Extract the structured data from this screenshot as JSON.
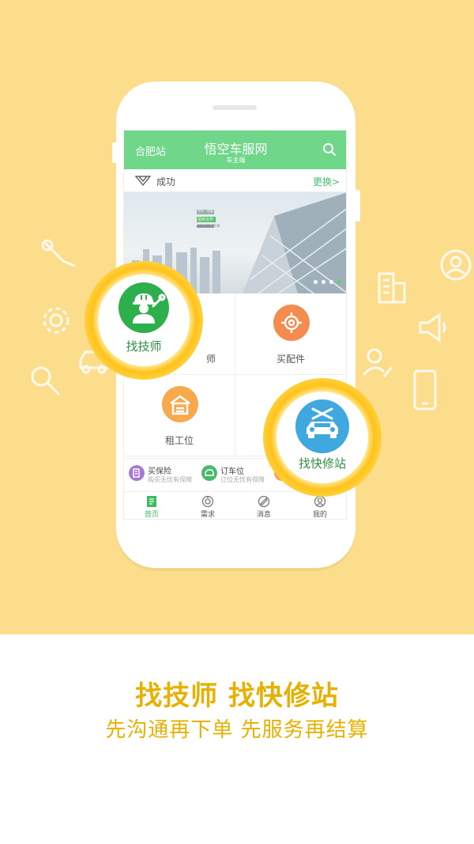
{
  "colors": {
    "background": "#fcdd8b",
    "accent": "#6fd68a",
    "headline": "#e6b100",
    "ring": "#ffc21a"
  },
  "app": {
    "city": "合肥站",
    "title": "悟空车服网",
    "subtitle": "车主端",
    "car_name": "成功",
    "change_label": "更换>",
    "banner": {
      "tag": "招商合作",
      "phone": "400-865-5538",
      "small": "合作 · 加盟",
      "active_slide": 4,
      "slide_count": 4
    }
  },
  "grid": {
    "tech_partial": "师",
    "parts": "买配件",
    "rent": "租工位"
  },
  "promos": [
    {
      "title": "买保险",
      "sub": "购买无忧有保障",
      "icon": "insurance-icon"
    },
    {
      "title": "订车位",
      "sub": "订位无忧有保障",
      "icon": "parking-icon"
    }
  ],
  "tabs": [
    {
      "label": "首页",
      "icon": "home-icon",
      "active": true
    },
    {
      "label": "需求",
      "icon": "demand-icon",
      "active": false
    },
    {
      "label": "消息",
      "icon": "message-icon",
      "active": false
    },
    {
      "label": "我的",
      "icon": "profile-icon",
      "active": false
    }
  ],
  "callouts": {
    "technician": "找技师",
    "repair_station": "找快修站"
  },
  "marketing": {
    "headline": "找技师 找快修站",
    "subline": "先沟通再下单 先服务再结算"
  }
}
